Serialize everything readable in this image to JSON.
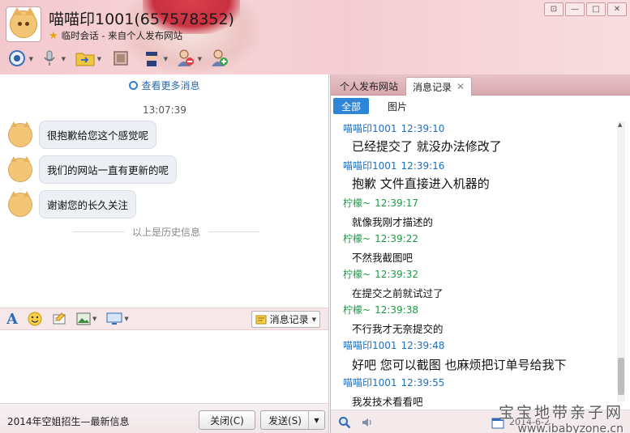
{
  "window": {
    "title": "喵喵印1001(657578352)",
    "subtitle": "临时会话 - 来自个人发布网站",
    "controls": [
      "⊡",
      "—",
      "□",
      "✕"
    ]
  },
  "toolbar": {
    "items": [
      {
        "name": "video-call-icon"
      },
      {
        "name": "voice-call-icon"
      },
      {
        "name": "file-transfer-icon"
      },
      {
        "name": "remote-desktop-icon"
      },
      {
        "name": "app-icon"
      },
      {
        "name": "remove-contact-icon"
      },
      {
        "name": "add-contact-icon"
      }
    ]
  },
  "chat": {
    "more_messages": "查看更多消息",
    "time": "13:07:39",
    "messages": [
      "很抱歉给您这个感觉呢",
      "我们的网站一直有更新的呢",
      "谢谢您的长久关注"
    ],
    "history_divider": "以上是历史信息"
  },
  "input_toolbar": {
    "history_button": "消息记录"
  },
  "bottom": {
    "ad_text": "2014年空姐招生—最新信息",
    "close_button": "关闭(C)",
    "send_button": "发送(S)"
  },
  "right_panel": {
    "tabs": [
      {
        "label": "个人发布网站",
        "active": false
      },
      {
        "label": "消息记录",
        "active": true
      }
    ],
    "filters": [
      "全部",
      "图片"
    ],
    "records": [
      {
        "sender": "喵喵印1001",
        "time": "12:39:10",
        "text": "已经提交了 就没办法修改了",
        "role": "me",
        "size": "big"
      },
      {
        "sender": "喵喵印1001",
        "time": "12:39:16",
        "text": "抱歉 文件直接进入机器的",
        "role": "me",
        "size": "big"
      },
      {
        "sender": "柠檬~",
        "time": "12:39:17",
        "text": "就像我刚才描述的",
        "role": "other",
        "size": "small"
      },
      {
        "sender": "柠檬~",
        "time": "12:39:22",
        "text": "不然我截图吧",
        "role": "other",
        "size": "small"
      },
      {
        "sender": "柠檬~",
        "time": "12:39:32",
        "text": "在提交之前就试过了",
        "role": "other",
        "size": "small"
      },
      {
        "sender": "柠檬~",
        "time": "12:39:38",
        "text": "不行我才无奈提交的",
        "role": "other",
        "size": "small"
      },
      {
        "sender": "喵喵印1001",
        "time": "12:39:48",
        "text": "好吧 您可以截图 也麻烦把订单号给我下",
        "role": "me",
        "size": "big"
      },
      {
        "sender": "喵喵印1001",
        "time": "12:39:55",
        "text": "我发技术看看吧",
        "role": "me",
        "size": "small"
      }
    ],
    "date_fragment": "2014-6-2"
  },
  "watermark": {
    "line1": "宝宝地带亲子网",
    "line2": "www.ibabyzone.cn"
  },
  "colors": {
    "accent_blue": "#2f86d9",
    "sender_me": "#1f6fc0",
    "sender_other": "#1e9a47",
    "header_pink": "#f4cdd1"
  }
}
